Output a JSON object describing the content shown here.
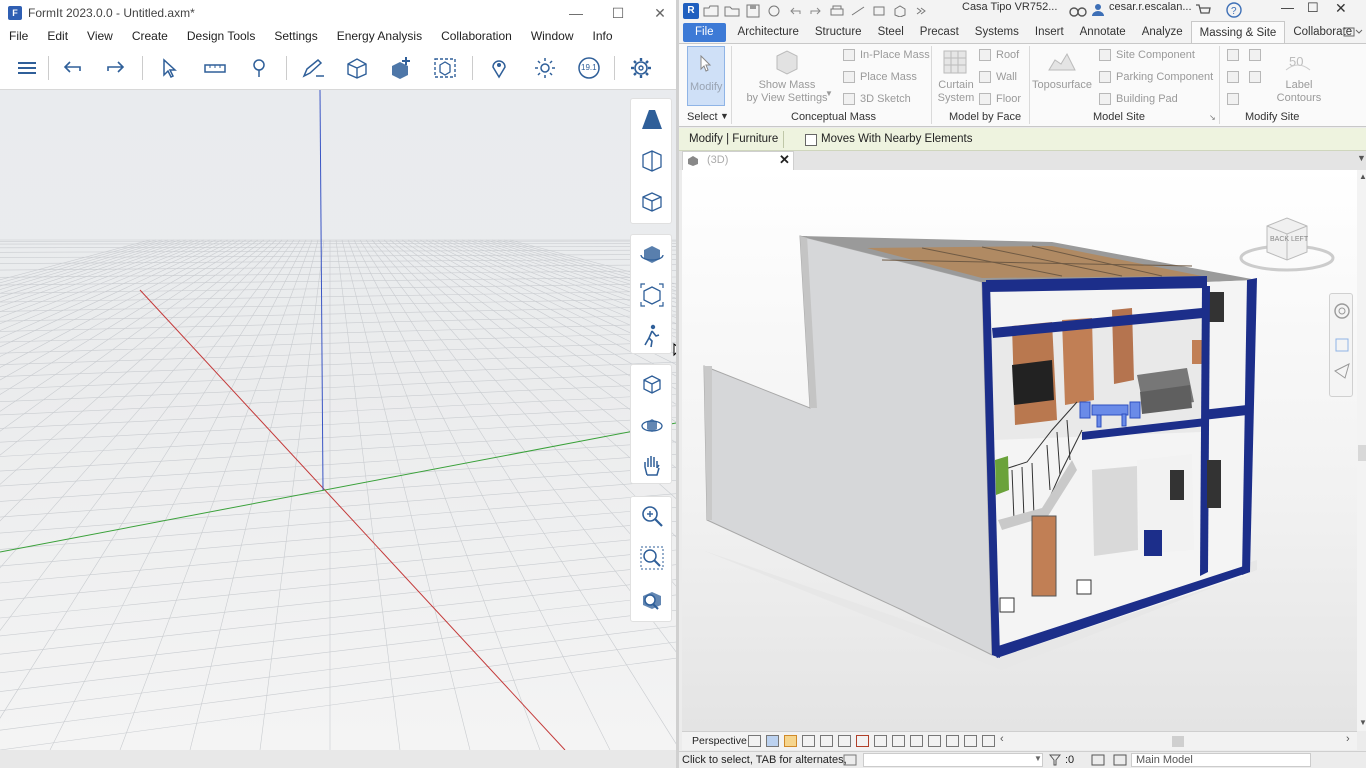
{
  "formit": {
    "title": "FormIt 2023.0.0 - Untitled.axm*",
    "menu": [
      "File",
      "Edit",
      "View",
      "Create",
      "Design Tools",
      "Settings",
      "Energy Analysis",
      "Collaboration",
      "Window",
      "Info"
    ],
    "toolbar_icons": [
      "layers-icon",
      "undo-icon",
      "redo-icon",
      "select-icon",
      "measure-icon",
      "paint-icon",
      "sketch-icon",
      "box-icon",
      "add-component-icon",
      "group-icon",
      "location-icon",
      "sun-icon",
      "scale-icon",
      "settings-icon"
    ],
    "scale_label": "19.1",
    "side_icons": [
      "view-perspective-icon",
      "view-cube-front-icon",
      "view-cube-iso-icon",
      "orbit-icon",
      "zoom-extents-icon",
      "walk-icon",
      "home-view-icon",
      "orbit-3d-icon",
      "pan-icon",
      "zoom-icon",
      "zoom-window-icon",
      "zoom-selection-icon"
    ]
  },
  "revit": {
    "doc_title": "Casa Tipo VR752...",
    "user": "cesar.r.escalan...",
    "tabs": [
      "File",
      "Architecture",
      "Structure",
      "Steel",
      "Precast",
      "Systems",
      "Insert",
      "Annotate",
      "Analyze",
      "Massing & Site",
      "Collaborate"
    ],
    "active_tab": "Massing & Site",
    "ribbon": {
      "modify_label": "Modify",
      "select_label": "Select",
      "show_mass_line1": "Show Mass",
      "show_mass_line2": "by View Settings",
      "in_place_mass": "In-Place Mass",
      "place_mass": "Place Mass",
      "sketch_3d": "3D Sketch",
      "curtain_system_line1": "Curtain",
      "curtain_system_line2": "System",
      "roof": "Roof",
      "wall": "Wall",
      "floor": "Floor",
      "toposurface": "Toposurface",
      "site_component": "Site Component",
      "parking_component": "Parking Component",
      "building_pad": "Building Pad",
      "label_contours_line1": "Label",
      "label_contours_line2": "Contours",
      "panel_conceptual_mass": "Conceptual Mass",
      "panel_model_by_face": "Model by Face",
      "panel_model_site": "Model Site",
      "panel_modify_site": "Modify Site"
    },
    "options_bar": {
      "context": "Modify | Furniture",
      "moves_with_nearby": "Moves With Nearby Elements"
    },
    "view_tab": "(3D)",
    "viewcube_back": "BACK",
    "viewcube_left": "LEFT",
    "view_control": "Perspective",
    "status_text": "Click to select, TAB for alternates,",
    "status_zero": ":0",
    "workset": "Main Model"
  }
}
